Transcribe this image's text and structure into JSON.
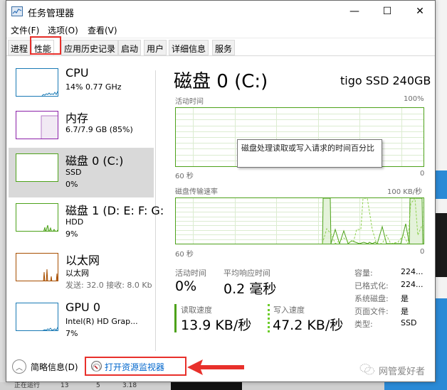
{
  "window": {
    "title": "任务管理器",
    "controls": {
      "minimize": "—",
      "maximize": "☐",
      "close": "✕"
    }
  },
  "menu": [
    "文件(F)",
    "选项(O)",
    "查看(V)"
  ],
  "tabs": [
    {
      "label": "进程",
      "active": false
    },
    {
      "label": "性能",
      "active": true
    },
    {
      "label": "应用历史记录",
      "active": false
    },
    {
      "label": "启动",
      "active": false
    },
    {
      "label": "用户",
      "active": false
    },
    {
      "label": "详细信息",
      "active": false
    },
    {
      "label": "服务",
      "active": false
    }
  ],
  "sidebar": {
    "items": [
      {
        "title": "CPU",
        "line1": "14% 0.77 GHz",
        "line2": "",
        "color": "#1a7ab5",
        "selected": false
      },
      {
        "title": "内存",
        "line1": "6.7/7.9 GB (85%)",
        "line2": "",
        "color": "#8b1fa8",
        "selected": false,
        "usage_fraction": 0.85
      },
      {
        "title": "磁盘 0 (C:)",
        "line1": "SSD",
        "line2": "0%",
        "color": "#4da21a",
        "selected": true
      },
      {
        "title": "磁盘 1 (D: E: F: G:",
        "line1": "HDD",
        "line2": "9%",
        "color": "#4da21a",
        "selected": false
      },
      {
        "title": "以太网",
        "line1": "以太网",
        "line2": "发送: 32.0 接收: 8.0 Kb",
        "color": "#a74f01",
        "selected": false
      },
      {
        "title": "GPU 0",
        "line1": "Intel(R) HD Grap...",
        "line2": "7%",
        "color": "#1a7ab5",
        "selected": false
      }
    ]
  },
  "main": {
    "title": "磁盘 0 (C:)",
    "model": "tigo SSD 240GB",
    "active_time_chart": {
      "label": "活动时间",
      "max_label": "100%",
      "x_left": "60 秒",
      "x_right": "0"
    },
    "tooltip": "磁盘处理读取或写入请求的时间百分比",
    "transfer_chart": {
      "label": "磁盘传输速率",
      "max_label": "100 KB/秒",
      "x_left": "60 秒",
      "x_right": "0"
    },
    "stats": {
      "active_time_label": "活动时间",
      "active_time_value": "0%",
      "avg_response_label": "平均响应时间",
      "avg_response_value": "0.2 毫秒",
      "read_label": "读取速度",
      "read_value": "13.9 KB/秒",
      "write_label": "写入速度",
      "write_value": "47.2 KB/秒"
    },
    "properties": [
      {
        "label": "容量:",
        "value": "224..."
      },
      {
        "label": "已格式化:",
        "value": "224..."
      },
      {
        "label": "系统磁盘:",
        "value": "是"
      },
      {
        "label": "页面文件:",
        "value": "是"
      },
      {
        "label": "类型:",
        "value": "SSD"
      }
    ]
  },
  "footer": {
    "fewer_details": "简略信息(D)",
    "open_resmon": "打开资源监视器"
  },
  "watermark": "网管爱好者",
  "background_text": {
    "bottom_left": "正在运行",
    "col1": "13",
    "col2": "5",
    "col3": "3.18"
  },
  "colors": {
    "disk": "#4da21a",
    "cpu": "#1a7ab5",
    "memory": "#8b1fa8",
    "ethernet": "#a74f01",
    "annotation": "#e8302b",
    "link": "#0066cc"
  }
}
